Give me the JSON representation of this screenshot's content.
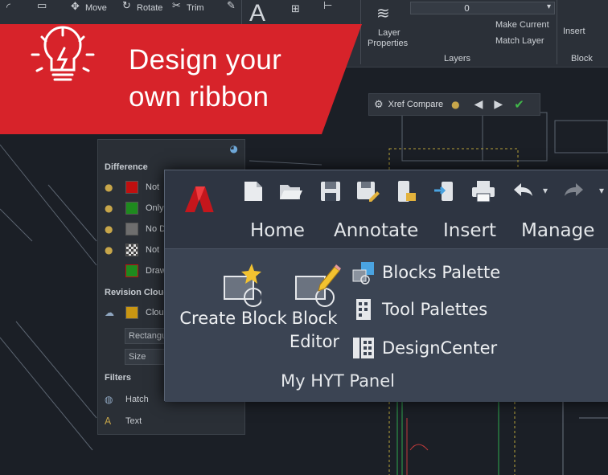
{
  "banner": {
    "line1": "Design your",
    "line2": "own ribbon",
    "color": "#d7232a",
    "icon": "lightbulb-bolt-icon"
  },
  "background_ribbon": {
    "tools": {
      "move": "Move",
      "rotate": "Rotate",
      "trim": "Trim"
    },
    "layer_properties_line1": "Layer",
    "layer_properties_line2": "Properties",
    "layer_value": "0",
    "make_current": "Make Current",
    "match_layer": "Match Layer",
    "layers_title": "Layers",
    "insert": "Insert",
    "block_title": "Block"
  },
  "xref_toolbar": {
    "label": "Xref Compare"
  },
  "palette": {
    "sections": {
      "difference": "Difference",
      "revision_cloud": "Revision Cloud",
      "filters": "Filters"
    },
    "difference_rows": [
      {
        "label": "Not",
        "color": "#c00f0f"
      },
      {
        "label": "Only",
        "color": "#1e8a1e"
      },
      {
        "label": "No D",
        "color": "#6e6e6e"
      },
      {
        "label": "Not",
        "color": "checker"
      },
      {
        "label": "Draw",
        "color": "#1e8a1e"
      }
    ],
    "cloud_row": {
      "label": "Clou",
      "color": "#c99612"
    },
    "shape_field": "Rectangu",
    "size_field": "Size",
    "filter_rows": [
      "Hatch",
      "Text"
    ]
  },
  "main_panel": {
    "app_logo": "autocad-logo",
    "tabs": [
      "Home",
      "Annotate",
      "Insert",
      "Manage"
    ],
    "create_block": "Create Block",
    "block_editor_line1": "Block",
    "block_editor_line2": "Editor",
    "blocks_palette": "Blocks Palette",
    "tool_palettes": "Tool Palettes",
    "design_center": "DesignCenter",
    "panel_title": "My HYT Panel",
    "accent": "#d7232a"
  }
}
